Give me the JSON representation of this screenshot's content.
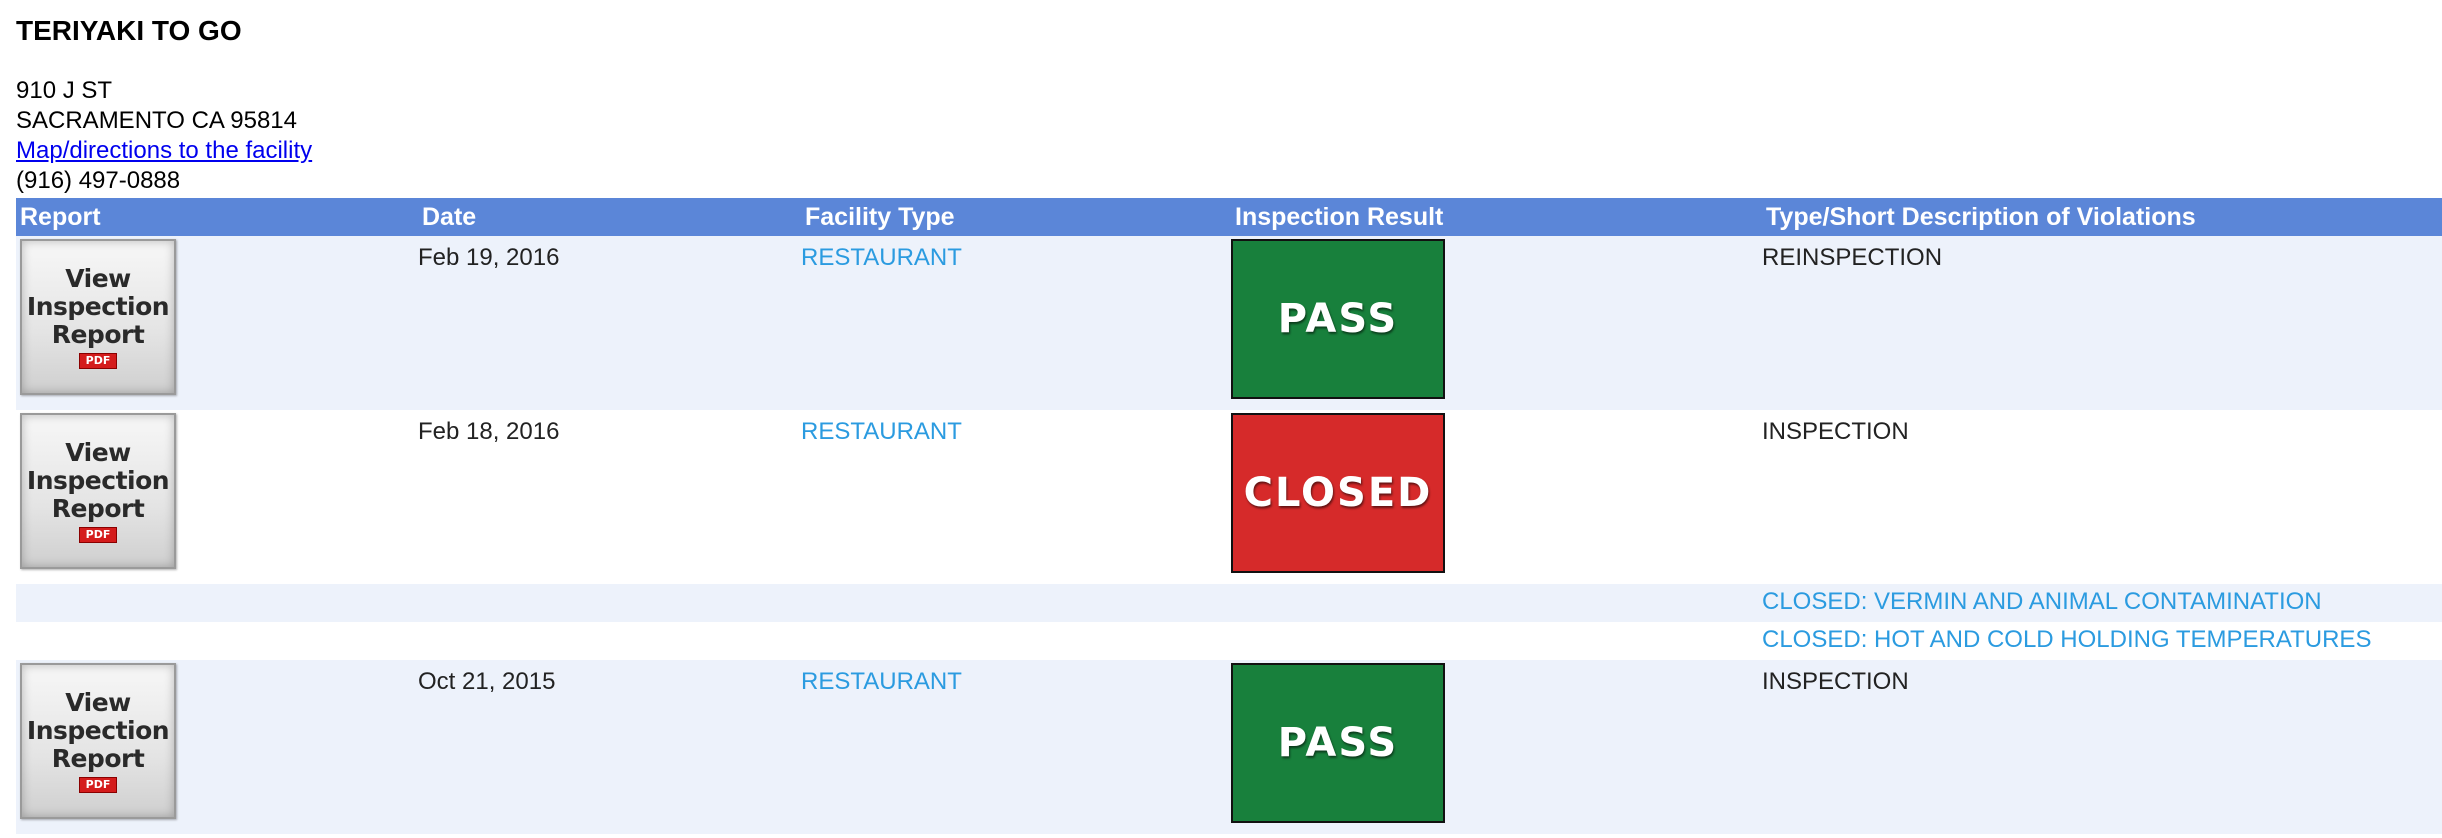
{
  "facility": {
    "name": "TERIYAKI TO GO",
    "address_line1": "910 J ST",
    "address_line2": "SACRAMENTO CA 95814",
    "map_link": "Map/directions to the facility",
    "phone": "(916) 497-0888"
  },
  "table": {
    "headers": [
      "Report",
      "Date",
      "Facility Type",
      "Inspection Result",
      "Type/Short Description of Violations"
    ],
    "report_button": {
      "line1": "View",
      "line2": "Inspection",
      "line3": "Report",
      "badge": "PDF"
    },
    "rows": [
      {
        "date": "Feb 19, 2016",
        "facility_type": "RESTAURANT",
        "result": "PASS",
        "result_color": "#18803c",
        "description": "REINSPECTION"
      },
      {
        "date": "Feb 18, 2016",
        "facility_type": "RESTAURANT",
        "result": "CLOSED",
        "result_color": "#d62a2a",
        "description": "INSPECTION"
      },
      {
        "date": "Oct 21, 2015",
        "facility_type": "RESTAURANT",
        "result": "PASS",
        "result_color": "#18803c",
        "description": "INSPECTION"
      }
    ],
    "violations": [
      "CLOSED: VERMIN AND ANIMAL CONTAMINATION",
      "CLOSED: HOT AND COLD HOLDING TEMPERATURES"
    ]
  },
  "colors": {
    "header_bg": "#5b86d8",
    "row_shade": "#edf2fb",
    "link_blue": "#2b9be0",
    "map_link": "#0000ee"
  }
}
